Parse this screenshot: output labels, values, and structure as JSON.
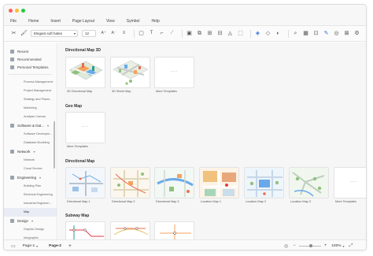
{
  "menu": [
    "File",
    "Home",
    "Insert",
    "Page Layout",
    "View",
    "Symbol",
    "Help"
  ],
  "toolbar": {
    "font": "Elegant soft hates",
    "size": "12"
  },
  "sidebar": {
    "top": [
      "Recent",
      "Recommended",
      "Personal Templates"
    ],
    "items": [
      {
        "type": "sub",
        "label": "Process Management"
      },
      {
        "type": "sub",
        "label": "Project Management"
      },
      {
        "type": "sub",
        "label": "Strategy and Planni..."
      },
      {
        "type": "sub",
        "label": "Marketing"
      },
      {
        "type": "sub",
        "label": "Analysis Canvas"
      },
      {
        "type": "cat",
        "label": "Software & Dat..."
      },
      {
        "type": "sub",
        "label": "Software Developm..."
      },
      {
        "type": "sub",
        "label": "Database Modeling"
      },
      {
        "type": "cat",
        "label": "Network"
      },
      {
        "type": "sub",
        "label": "Network"
      },
      {
        "type": "sub",
        "label": "Cloud Service"
      },
      {
        "type": "cat",
        "label": "Engineering"
      },
      {
        "type": "sub",
        "label": "Building Plan"
      },
      {
        "type": "sub",
        "label": "Electrical Engineering"
      },
      {
        "type": "sub",
        "label": "Industrial Engineeri..."
      },
      {
        "type": "sub",
        "label": "Map"
      },
      {
        "type": "cat",
        "label": "Design"
      },
      {
        "type": "sub",
        "label": "Graphic Design"
      },
      {
        "type": "sub",
        "label": "Infographic"
      }
    ]
  },
  "sections": [
    {
      "title": "Directional Map 3D",
      "cards": [
        "3D Directional Map",
        "3D Street Map",
        "More Templates"
      ]
    },
    {
      "title": "Geo Map",
      "cards": [
        "More Templates"
      ]
    },
    {
      "title": "Directional Map",
      "cards": [
        "Directional Map 1",
        "Directional Map 2",
        "Directional Map 3",
        "Location Map 1",
        "Location Map 2",
        "Location Map 3",
        "More Templates"
      ]
    },
    {
      "title": "Subway Map",
      "cards": []
    }
  ],
  "bottom": {
    "page_tab_1": "Page-1",
    "page_tab_2": "Page-2",
    "zoom": "100%"
  },
  "colors": {
    "accent": "#2f6fe4",
    "dot_red": "#ff5f57",
    "dot_yellow": "#febc2e",
    "dot_green": "#28c840"
  }
}
